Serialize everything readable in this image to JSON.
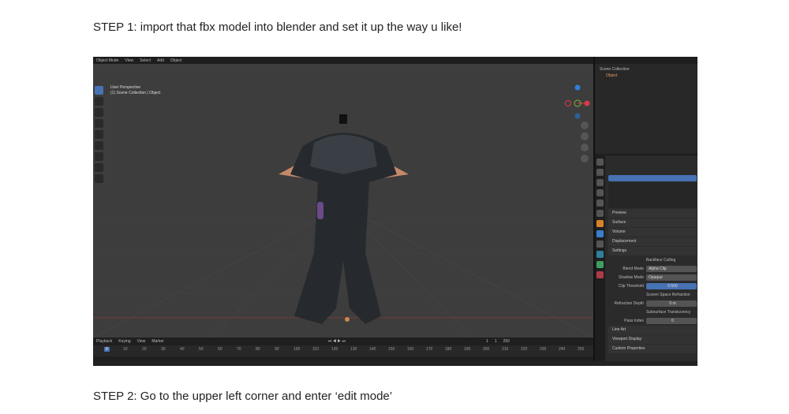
{
  "step1": "STEP 1: import that fbx model into blender and set it up the way u like!",
  "step2": "STEP 2: Go to the upper left corner and enter ‘edit mode’",
  "blender": {
    "menu": [
      "Object Mode",
      "View",
      "Select",
      "Add",
      "Object"
    ],
    "viewport_info": [
      "User Perspective",
      "(1) Scene Collection | Object"
    ],
    "outliner": {
      "items": [
        "Scene Collection",
        "Object"
      ]
    },
    "properties": {
      "panels_top": [
        "Preview",
        "Surface",
        "Volume",
        "Displacement",
        "Settings"
      ],
      "settings": {
        "backface": "Backface Culling",
        "blend_label": "Blend Mode",
        "blend": "Alpha Clip",
        "shadow_label": "Shadow Mode",
        "shadow": "Opaque",
        "clip_label": "Clip Threshold",
        "clip": "0.500",
        "ssr": "Screen Space Refraction",
        "refr_label": "Refraction Depth",
        "refr": "0 m",
        "sss": "Subsurface Translucency",
        "pass_label": "Pass Index",
        "pass": "0"
      },
      "panels_bottom": [
        "Line Art",
        "Viewport Display",
        "Custom Properties"
      ]
    },
    "timeline": {
      "menu": [
        "Playback",
        "Keying",
        "View",
        "Marker"
      ],
      "current_frame": "1",
      "start": "1",
      "end": "250",
      "ticks": [
        "0",
        "10",
        "20",
        "30",
        "40",
        "50",
        "60",
        "70",
        "80",
        "90",
        "100",
        "110",
        "120",
        "130",
        "140",
        "150",
        "160",
        "170",
        "180",
        "190",
        "200",
        "210",
        "220",
        "230",
        "240",
        "250"
      ]
    }
  }
}
